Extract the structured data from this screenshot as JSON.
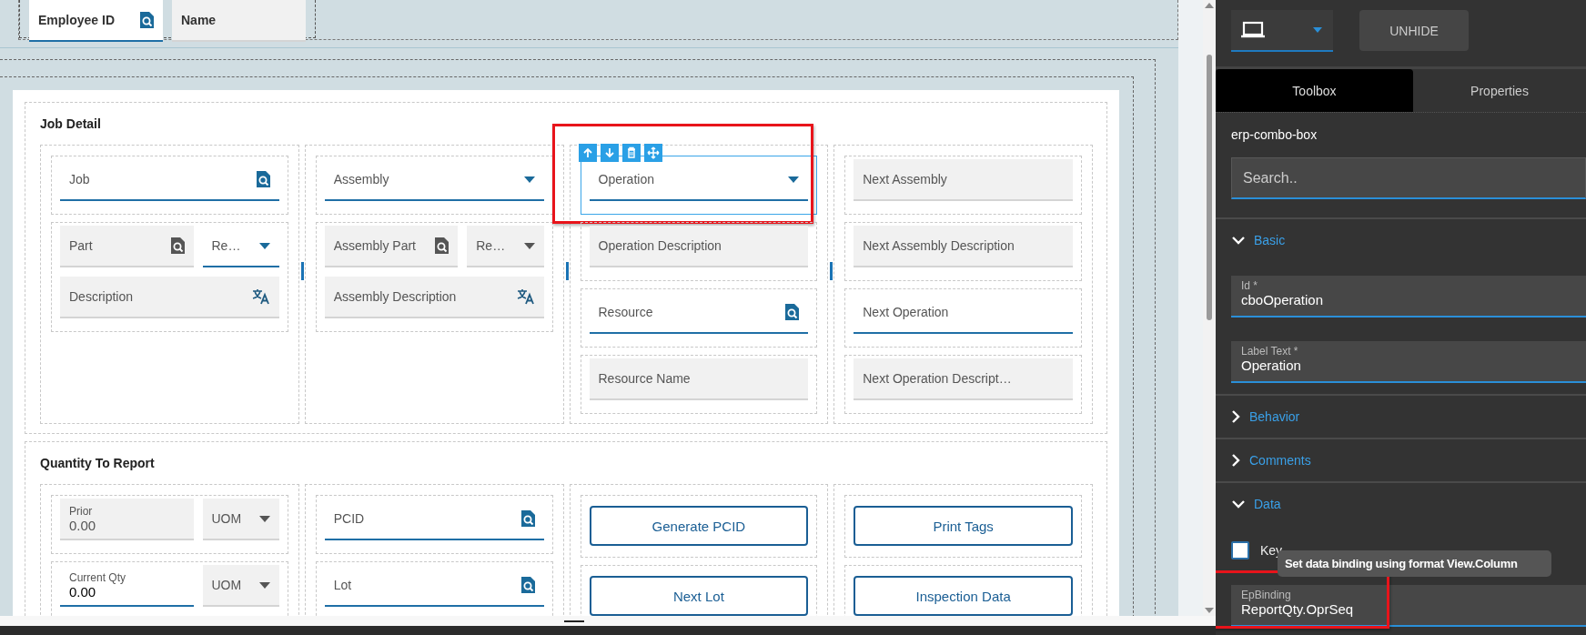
{
  "header_fields": [
    {
      "kind": "search",
      "label": "Employee ID",
      "readonly": false
    },
    {
      "kind": "text",
      "label": "Name",
      "readonly": true
    }
  ],
  "sections": [
    {
      "title": "Job Detail",
      "resizable": true,
      "columns": [
        {
          "cells": [
            {
              "selected": false,
              "rows": [
                {
                  "fields": [
                    {
                      "kind": "search",
                      "label": "Job",
                      "readonly": false
                    }
                  ]
                }
              ]
            },
            {
              "selected": false,
              "rows": [
                {
                  "fields": [
                    {
                      "kind": "search",
                      "label": "Part",
                      "readonly": true
                    },
                    {
                      "kind": "combo",
                      "label": "Re…",
                      "readonly": false
                    }
                  ]
                },
                {
                  "fields": [
                    {
                      "kind": "translate",
                      "label": "Description",
                      "readonly": true
                    }
                  ]
                }
              ]
            }
          ]
        },
        {
          "cells": [
            {
              "selected": false,
              "rows": [
                {
                  "fields": [
                    {
                      "kind": "combo",
                      "label": "Assembly",
                      "readonly": false
                    }
                  ]
                }
              ]
            },
            {
              "selected": false,
              "rows": [
                {
                  "fields": [
                    {
                      "kind": "search",
                      "label": "Assembly Part",
                      "readonly": true
                    },
                    {
                      "kind": "combo",
                      "label": "Re…",
                      "readonly": true
                    }
                  ]
                },
                {
                  "fields": [
                    {
                      "kind": "translate",
                      "label": "Assembly Description",
                      "readonly": true
                    }
                  ]
                }
              ]
            }
          ]
        },
        {
          "cells": [
            {
              "selected": true,
              "annotated": true,
              "rows": [
                {
                  "fields": [
                    {
                      "kind": "combo",
                      "label": "Operation",
                      "readonly": false
                    }
                  ]
                }
              ]
            },
            {
              "selected": false,
              "rows": [
                {
                  "fields": [
                    {
                      "kind": "text",
                      "label": "Operation Description",
                      "readonly": true
                    }
                  ]
                }
              ]
            },
            {
              "selected": false,
              "rows": [
                {
                  "fields": [
                    {
                      "kind": "search",
                      "label": "Resource",
                      "readonly": false
                    }
                  ]
                }
              ]
            },
            {
              "selected": false,
              "rows": [
                {
                  "fields": [
                    {
                      "kind": "text",
                      "label": "Resource Name",
                      "readonly": true
                    }
                  ]
                }
              ]
            }
          ]
        },
        {
          "cells": [
            {
              "selected": false,
              "rows": [
                {
                  "fields": [
                    {
                      "kind": "text",
                      "label": "Next Assembly",
                      "readonly": true
                    }
                  ]
                }
              ]
            },
            {
              "selected": false,
              "rows": [
                {
                  "fields": [
                    {
                      "kind": "text",
                      "label": "Next Assembly Description",
                      "readonly": true
                    }
                  ]
                }
              ]
            },
            {
              "selected": false,
              "rows": [
                {
                  "fields": [
                    {
                      "kind": "text",
                      "label": "Next Operation",
                      "readonly": false
                    }
                  ]
                }
              ]
            },
            {
              "selected": false,
              "rows": [
                {
                  "fields": [
                    {
                      "kind": "text",
                      "label": "Next Operation Descript…",
                      "readonly": true
                    }
                  ]
                }
              ]
            }
          ]
        }
      ]
    },
    {
      "title": "Quantity To Report",
      "resizable": false,
      "columns": [
        {
          "cells": [
            {
              "selected": false,
              "rows": [
                {
                  "fields": [
                    {
                      "kind": "text",
                      "label": "Prior",
                      "value": "0.00",
                      "readonly": true
                    },
                    {
                      "kind": "combo",
                      "label": "UOM",
                      "readonly": true
                    }
                  ]
                }
              ]
            },
            {
              "selected": false,
              "rows": [
                {
                  "fields": [
                    {
                      "kind": "text",
                      "label": "Current Qty",
                      "value": "0.00",
                      "readonly": false
                    },
                    {
                      "kind": "combo",
                      "label": "UOM",
                      "readonly": true
                    }
                  ]
                }
              ]
            }
          ]
        },
        {
          "cells": [
            {
              "selected": false,
              "rows": [
                {
                  "fields": [
                    {
                      "kind": "search",
                      "label": "PCID",
                      "readonly": false
                    }
                  ]
                }
              ]
            },
            {
              "selected": false,
              "rows": [
                {
                  "fields": [
                    {
                      "kind": "search",
                      "label": "Lot",
                      "readonly": false
                    }
                  ]
                }
              ]
            }
          ]
        },
        {
          "cells": [
            {
              "selected": false,
              "rows": [
                {
                  "fields": [
                    {
                      "kind": "button",
                      "label": "Generate PCID"
                    }
                  ]
                }
              ]
            },
            {
              "selected": false,
              "rows": [
                {
                  "fields": [
                    {
                      "kind": "button",
                      "label": "Next Lot"
                    }
                  ]
                }
              ]
            }
          ]
        },
        {
          "cells": [
            {
              "selected": false,
              "rows": [
                {
                  "fields": [
                    {
                      "kind": "button",
                      "label": "Print Tags"
                    }
                  ]
                }
              ]
            },
            {
              "selected": false,
              "rows": [
                {
                  "fields": [
                    {
                      "kind": "button",
                      "label": "Inspection Data"
                    }
                  ]
                }
              ]
            }
          ]
        }
      ]
    }
  ],
  "panel": {
    "unhide_button": "UNHIDE",
    "tabs": [
      {
        "label": "Toolbox",
        "selected": true
      },
      {
        "label": "Properties",
        "selected": false
      }
    ],
    "component": "erp-combo-box",
    "search": {
      "placeholder": "Search.."
    },
    "groups": [
      {
        "title": "Basic",
        "expanded": true,
        "items": [
          {
            "kind": "field",
            "label": "Id *",
            "value": "cboOperation"
          },
          {
            "kind": "field",
            "label": "Label Text *",
            "value": "Operation"
          }
        ]
      },
      {
        "title": "Behavior",
        "expanded": false
      },
      {
        "title": "Comments",
        "expanded": false
      },
      {
        "title": "Data",
        "expanded": true,
        "items": [
          {
            "kind": "checkbox",
            "label": "Key",
            "checked": false
          },
          {
            "kind": "field",
            "label": "EpBinding",
            "value": "ReportQty.OprSeq",
            "annotated": true
          }
        ]
      }
    ],
    "tooltip": "Set data binding using format View.Column"
  }
}
